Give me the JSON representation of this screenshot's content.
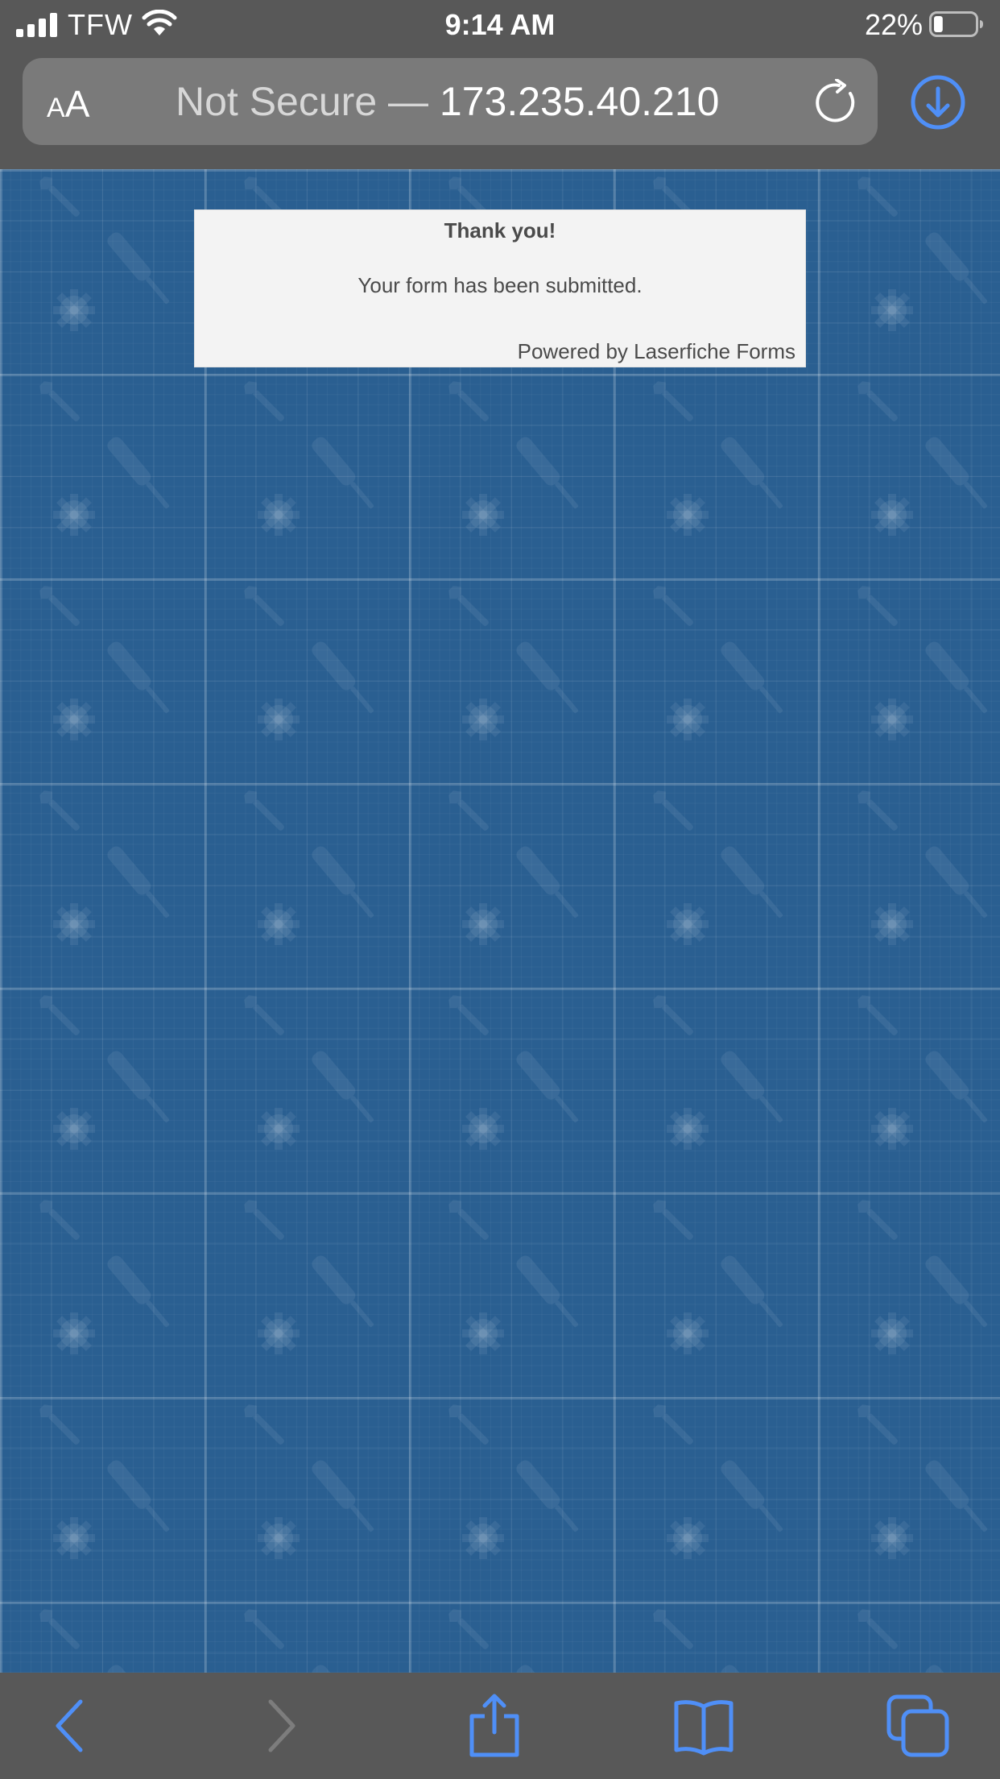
{
  "status_bar": {
    "carrier": "TFW",
    "time": "9:14 AM",
    "battery_percent": "22%",
    "battery_level": 0.22,
    "signal_bars": 4
  },
  "address_bar": {
    "text_size_small": "A",
    "text_size_large": "A",
    "security_prefix": "Not Secure —",
    "host": "173.235.40.210"
  },
  "page": {
    "background_color": "#2a5f91",
    "confirmation": {
      "title": "Thank you!",
      "message": "Your form has been submitted.",
      "footer": "Powered by Laserfiche Forms"
    }
  },
  "colors": {
    "chrome_bg": "#585858",
    "url_field_bg": "#7a7a7a",
    "accent_blue": "#4f8ff7",
    "disabled_gray": "#7d7d7d"
  },
  "icons": {
    "reload": "reload-icon",
    "download": "download-icon",
    "back": "back-chevron-icon",
    "forward": "forward-chevron-icon",
    "share": "share-icon",
    "bookmarks": "bookmarks-icon",
    "tabs": "tabs-icon"
  }
}
